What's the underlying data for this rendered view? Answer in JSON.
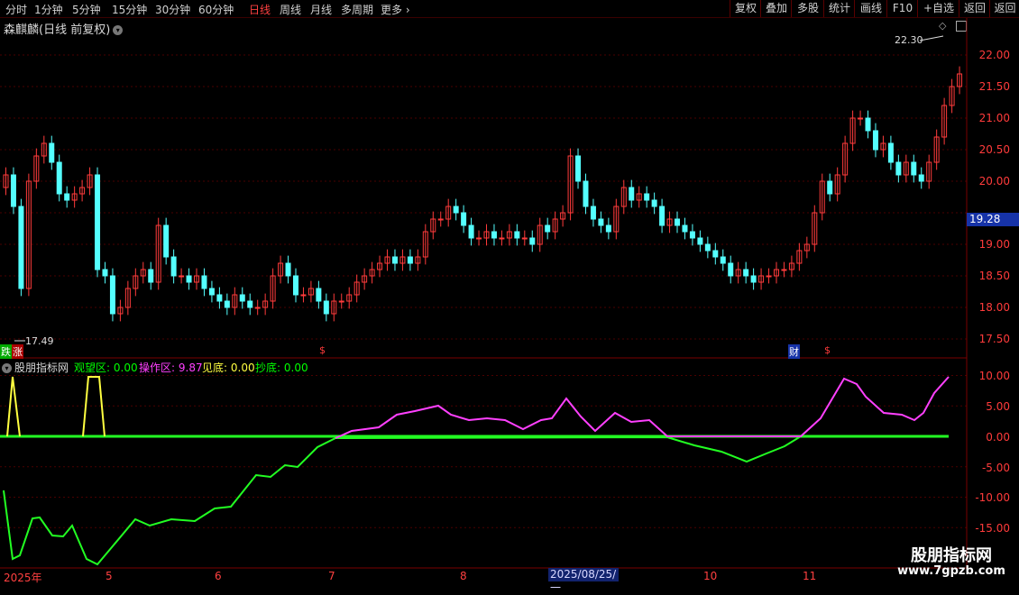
{
  "toolbar": {
    "periods": [
      "分时",
      "1分钟",
      "5分钟",
      "15分钟",
      "30分钟",
      "60分钟",
      "日线",
      "周线",
      "月线",
      "多周期",
      "更多"
    ],
    "active_period": "日线",
    "more_icon": "chevron-right-icon",
    "right_buttons": [
      "复权",
      "叠加",
      "多股",
      "统计",
      "画线",
      "F10",
      "+自选",
      "返回"
    ]
  },
  "main_chart": {
    "title": "森麒麟(日线 前复权)",
    "title_icon": "chevron-down-icon",
    "high_label": "22.30",
    "low_label": "17.49",
    "current_price": "19.28",
    "y_ticks": [
      "22.00",
      "21.50",
      "21.00",
      "20.50",
      "20.00",
      "19.50",
      "19.00",
      "18.50",
      "18.00",
      "17.50"
    ],
    "markers": {
      "die": "跌",
      "zhang": "涨",
      "cai": "财",
      "dollar": "$"
    },
    "colors": {
      "up": "#ff3b3b",
      "down": "#54ffff",
      "grid": "#5a0000",
      "axis_text": "#ff3b3b"
    }
  },
  "indicator": {
    "name": "股朋指标网",
    "fields": [
      {
        "label": "观望区:",
        "value": "0.00",
        "color": "#00ff00"
      },
      {
        "label": "操作区:",
        "value": "9.87",
        "color": "#ff40ff"
      },
      {
        "label": "见底:",
        "value": "0.00",
        "color": "#ffff40"
      },
      {
        "label": "抄底:",
        "value": "0.00",
        "color": "#00ff00"
      }
    ],
    "y_ticks": [
      "10.00",
      "5.00",
      "0.00",
      "-5.00",
      "-10.00",
      "-15.00"
    ]
  },
  "date_axis": {
    "labels": [
      "2025年",
      "5",
      "6",
      "7",
      "8",
      "10",
      "11"
    ],
    "cursor_date": "2025/08/25/一"
  },
  "watermark": {
    "title": "股朋指标网",
    "url": "www.7gpzb.com"
  }
}
